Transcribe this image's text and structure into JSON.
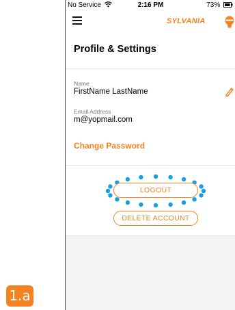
{
  "step_badge": "1.a",
  "status_bar": {
    "carrier": "No Service",
    "time": "2:16 PM",
    "battery": "73%"
  },
  "header": {
    "brand": "SYLVANIA",
    "title": "Profile & Settings"
  },
  "profile": {
    "name_label": "Name",
    "name_value": "FirstName LastName",
    "email_label": "Email Address",
    "email_value": "m@yopmail.com",
    "change_password": "Change Password"
  },
  "actions": {
    "logout": "LOGOUT",
    "delete_account": "DELETE ACCOUNT"
  },
  "colors": {
    "accent": "#f58220",
    "highlight_dots": "#1a9ee0"
  },
  "icons": [
    "wifi-icon",
    "battery-icon",
    "menu-icon",
    "bulb-icon",
    "pencil-icon"
  ]
}
